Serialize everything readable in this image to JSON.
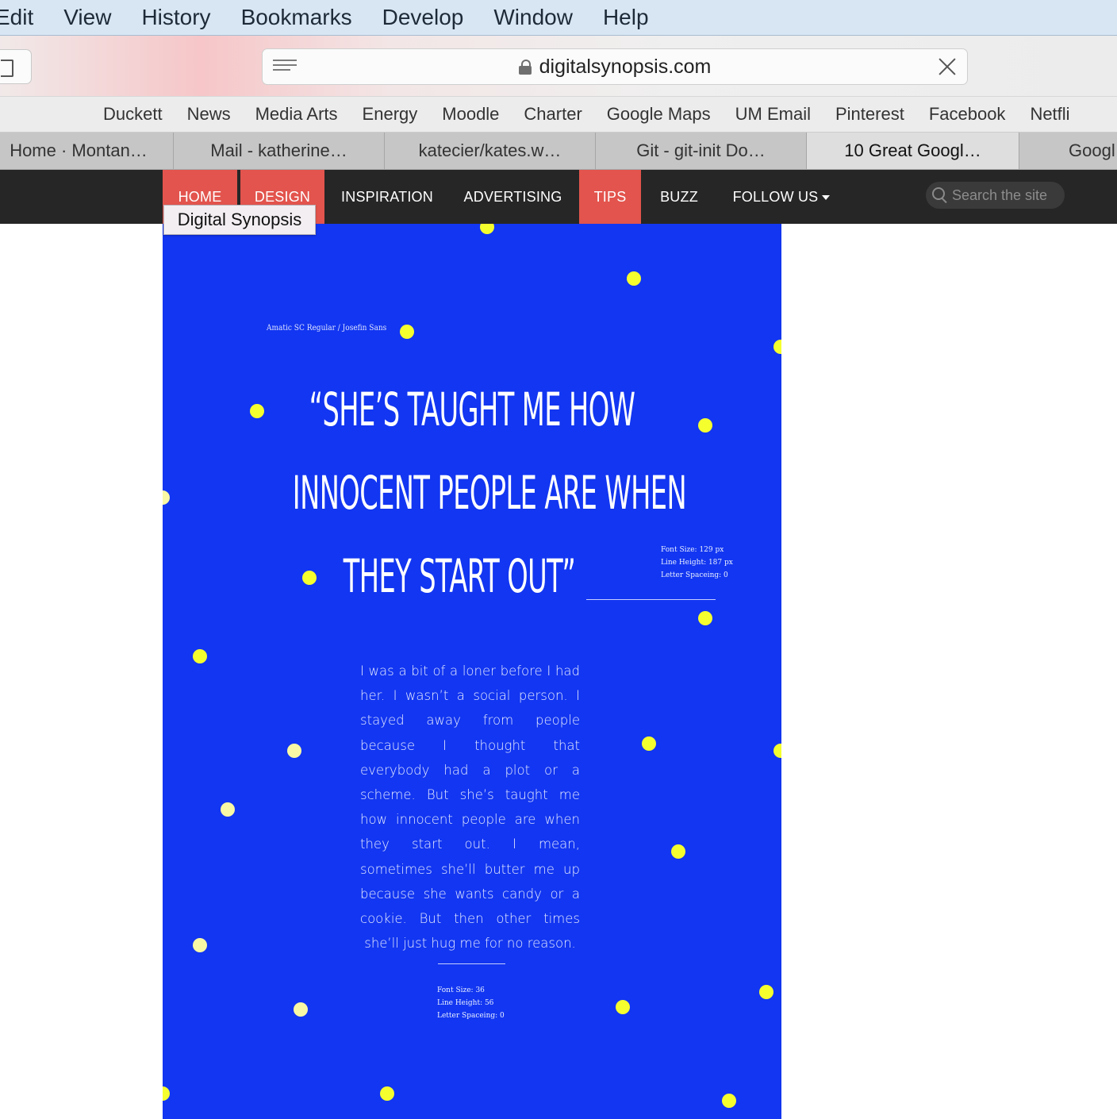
{
  "menubar": {
    "items": [
      "Edit",
      "View",
      "History",
      "Bookmarks",
      "Develop",
      "Window",
      "Help"
    ]
  },
  "toolbar": {
    "url": "digitalsynopsis.com",
    "icons": {
      "sidebar": "sidebar-icon",
      "reader": "reader-icon",
      "lock": "lock-icon",
      "clear": "close-icon"
    }
  },
  "bookmarks": [
    "Duckett",
    "News",
    "Media Arts",
    "Energy",
    "Moodle",
    "Charter",
    "Google Maps",
    "UM Email",
    "Pinterest",
    "Facebook",
    "Netfli"
  ],
  "tabs": [
    {
      "label": "Home · Montan…",
      "active": false
    },
    {
      "label": "Mail - katherine…",
      "active": false
    },
    {
      "label": "katecier/kates.w…",
      "active": false
    },
    {
      "label": "Git - git-init Do…",
      "active": false
    },
    {
      "label": "10 Great Googl…",
      "active": true
    },
    {
      "label": "Googl",
      "active": false
    }
  ],
  "site_nav": {
    "items": [
      "HOME",
      "DESIGN",
      "INSPIRATION",
      "ADVERTISING",
      "TIPS",
      "BUZZ",
      "FOLLOW US"
    ],
    "search_placeholder": "Search the site",
    "tooltip": "Digital Synopsis",
    "accent_color": "#e2544d",
    "bar_color": "#262626"
  },
  "poster": {
    "background_color": "#1236f1",
    "dot_color": "#f5ff2e",
    "font_credit": "Amatic SC Regular  /  Josefin Sans",
    "quote_lines": [
      "“SHE’S TAUGHT ME HOW",
      "INNOCENT PEOPLE ARE WHEN",
      "THEY START OUT”"
    ],
    "quote_spec": [
      "Font Size: 129 px",
      "Line Height: 187 px",
      "Letter Spaceing: 0"
    ],
    "body_text": "I was a bit of a loner before I had her. I wasn’t a social person. I stayed away from people because I thought that everybody had a plot or a scheme. But she’s taught me how innocent people are when they start out. I mean, sometimes she’ll butter me up because she wants candy or a cookie. But then other times she’ll just hug me for no reason.",
    "body_spec": [
      "Font Size: 36",
      "Line Height: 56",
      "Letter Spaceing: 0"
    ]
  }
}
